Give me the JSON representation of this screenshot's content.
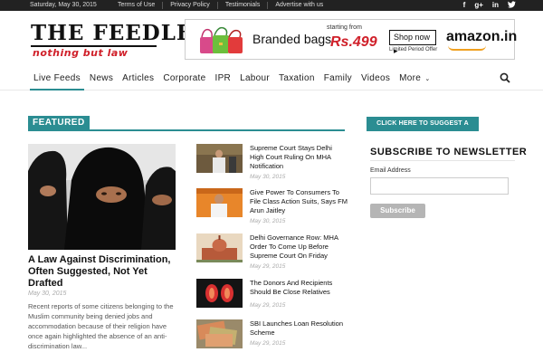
{
  "topbar": {
    "date": "Saturday, May 30, 2015",
    "links": [
      "Terms of Use",
      "Privacy Policy",
      "Testimonials",
      "Advertise with us"
    ],
    "social": [
      "f",
      "g+",
      "in",
      "t"
    ],
    "social_icons": [
      "facebook-icon",
      "google-plus-icon",
      "linkedin-icon",
      "twitter-icon"
    ]
  },
  "logo": {
    "title": "THE FEEDLEX",
    "tagline": "nothing but law"
  },
  "ad": {
    "brand_text": "Branded bags",
    "starting_from": "starting from",
    "price": "Rs.499",
    "shop_now": "Shop now",
    "offer": "Limited Period Offer",
    "amazon": "amazon.in"
  },
  "nav": {
    "items": [
      "Live Feeds",
      "News",
      "Articles",
      "Corporate",
      "IPR",
      "Labour",
      "Taxation",
      "Family",
      "Videos",
      "More"
    ],
    "active": "Live Feeds"
  },
  "featured": {
    "label": "FEATURED",
    "main": {
      "title": "A Law Against Discrimination, Often Suggested, Not Yet Drafted",
      "date": "May 30, 2015",
      "excerpt": "Recent reports of some citizens belonging to the Muslim community being denied jobs and accommodation because of their religion have once again highlighted the absence of an anti-discrimination law..."
    },
    "list": [
      {
        "title": "Supreme Court Stays Delhi High Court Ruling On MHA Notification",
        "date": "May 30, 2015"
      },
      {
        "title": "Give Power To Consumers To File Class Action Suits, Says FM Arun Jaitley",
        "date": "May 30, 2015"
      },
      {
        "title": "Delhi Governance Row: MHA Order To Come Up Before Supreme Court On Friday",
        "date": "May 29, 2015"
      },
      {
        "title": "The Donors And Recipients Should Be Close Relatives",
        "date": "May 29, 2015"
      },
      {
        "title": "SBI Launches Loan Resolution Scheme",
        "date": "May 29, 2015"
      }
    ]
  },
  "sidebar": {
    "suggest_button": "CLICK HERE TO SUGGEST A STORY",
    "newsletter_title": "SUBSCRIBE TO NEWSLETTER",
    "email_label": "Email Address",
    "email_value": "",
    "subscribe_button": "Subscribe"
  },
  "colors": {
    "accent": "#2b8d92",
    "topbar": "#222222",
    "logo_red": "#d0202a"
  }
}
